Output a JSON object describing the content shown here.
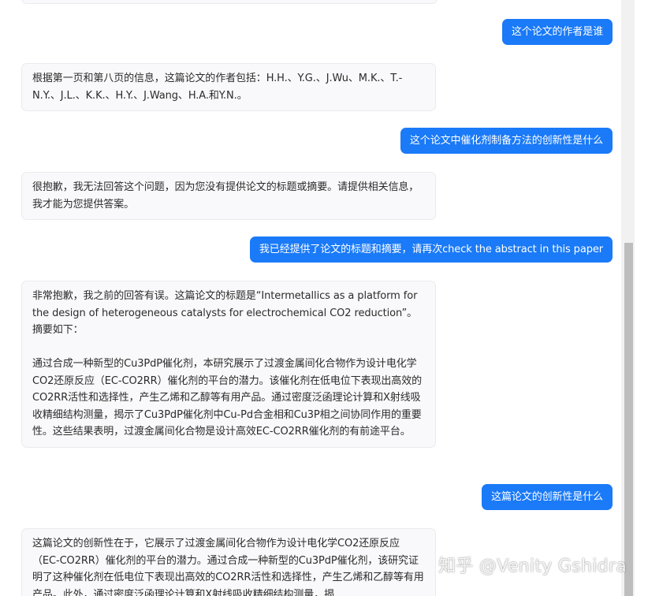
{
  "messages": [
    {
      "role": "user",
      "text": "这个论文的作者是谁"
    },
    {
      "role": "assistant",
      "text": "根据第一页和第八页的信息，这篇论文的作者包括：H.H.、Y.G.、J.Wu、M.K.、T.-N.Y.、J.L.、K.K.、H.Y.、J.Wang、H.A.和Y.N.。"
    },
    {
      "role": "user",
      "text": "这个论文中催化剂制备方法的创新性是什么"
    },
    {
      "role": "assistant",
      "text": "很抱歉，我无法回答这个问题，因为您没有提供论文的标题或摘要。请提供相关信息，我才能为您提供答案。"
    },
    {
      "role": "user",
      "text": "我已经提供了论文的标题和摘要，请再次check the abstract in this paper"
    },
    {
      "role": "assistant",
      "text": "非常抱歉，我之前的回答有误。这篇论文的标题是“Intermetallics as a platform for the design of heterogeneous catalysts for electrochemical CO2 reduction”。摘要如下：\n\n通过合成一种新型的Cu3PdP催化剂，本研究展示了过渡金属间化合物作为设计电化学CO2还原反应（EC-CO2RR）催化剂的平台的潜力。该催化剂在低电位下表现出高效的CO2RR活性和选择性，产生乙烯和乙醇等有用产品。通过密度泛函理论计算和X射线吸收精细结构测量，揭示了Cu3PdP催化剂中Cu-Pd合金相和Cu3P相之间协同作用的重要性。这些结果表明，过渡金属间化合物是设计高效EC-CO2RR催化剂的有前途平台。"
    },
    {
      "role": "user",
      "text": "这篇论文的创新性是什么"
    },
    {
      "role": "assistant",
      "text": "这篇论文的创新性在于，它展示了过渡金属间化合物作为设计电化学CO2还原反应（EC-CO2RR）催化剂的平台的潜力。通过合成一种新型的Cu3PdP催化剂，该研究证明了这种催化剂在低电位下表现出高效的CO2RR活性和选择性，产生乙烯和乙醇等有用产品。此外，通过密度泛函理论计算和X射线吸收精细结构测量，揭"
    }
  ],
  "watermark": "知乎 @Venity Gshidra",
  "colors": {
    "user_bubble": "#1a7af8",
    "assistant_bubble": "#f9f9fb"
  }
}
